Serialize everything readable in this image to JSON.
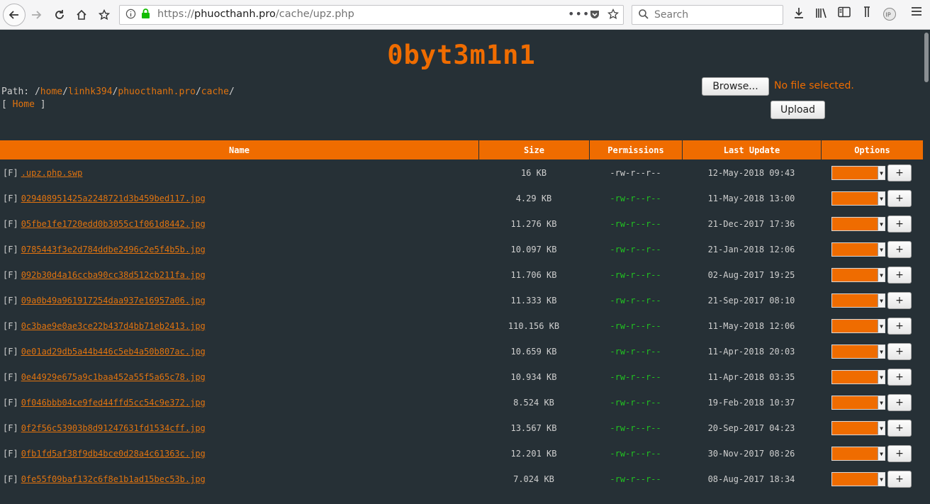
{
  "browser": {
    "url_prefix": "https://",
    "url_host": "phuocthanh.pro",
    "url_path": "/cache/upz.php",
    "search_placeholder": "Search"
  },
  "page": {
    "title": "0byt3m1n1",
    "path_label": "Path:",
    "path_sep": "/",
    "path_segments": [
      "home",
      "linhk394",
      "phuocthanh.pro",
      "cache"
    ],
    "home_open": "[",
    "home_link": "Home",
    "home_close": "]",
    "browse_label": "Browse...",
    "no_file_label": "No file selected.",
    "upload_label": "Upload"
  },
  "table": {
    "headers": [
      "Name",
      "Size",
      "Permissions",
      "Last Update",
      "Options"
    ],
    "type_tag": "[F]",
    "plus_label": "+",
    "rows": [
      {
        "name": ".upz.php.swp",
        "size": "16 KB",
        "perm": "-rw-r--r--",
        "perm_color": "#cfcfcf",
        "date": "12-May-2018 09:43"
      },
      {
        "name": "029408951425a2248721d3b459bed117.jpg",
        "size": "4.29 KB",
        "perm": "-rw-r--r--",
        "perm_color": "#21c321",
        "date": "11-May-2018 13:00"
      },
      {
        "name": "05fbe1fe1720edd0b3055c1f061d8442.jpg",
        "size": "11.276 KB",
        "perm": "-rw-r--r--",
        "perm_color": "#21c321",
        "date": "21-Dec-2017 17:36"
      },
      {
        "name": "0785443f3e2d784ddbe2496c2e5f4b5b.jpg",
        "size": "10.097 KB",
        "perm": "-rw-r--r--",
        "perm_color": "#21c321",
        "date": "21-Jan-2018 12:06"
      },
      {
        "name": "092b30d4a16ccba90cc38d512cb211fa.jpg",
        "size": "11.706 KB",
        "perm": "-rw-r--r--",
        "perm_color": "#21c321",
        "date": "02-Aug-2017 19:25"
      },
      {
        "name": "09a0b49a961917254daa937e16957a06.jpg",
        "size": "11.333 KB",
        "perm": "-rw-r--r--",
        "perm_color": "#21c321",
        "date": "21-Sep-2017 08:10"
      },
      {
        "name": "0c3bae9e0ae3ce22b437d4bb71eb2413.jpg",
        "size": "110.156 KB",
        "perm": "-rw-r--r--",
        "perm_color": "#21c321",
        "date": "11-May-2018 12:06"
      },
      {
        "name": "0e01ad29db5a44b446c5eb4a50b807ac.jpg",
        "size": "10.659 KB",
        "perm": "-rw-r--r--",
        "perm_color": "#21c321",
        "date": "11-Apr-2018 20:03"
      },
      {
        "name": "0e44929e675a9c1baa452a55f5a65c78.jpg",
        "size": "10.934 KB",
        "perm": "-rw-r--r--",
        "perm_color": "#21c321",
        "date": "11-Apr-2018 03:35"
      },
      {
        "name": "0f046bbb04ce9fed44ffd5cc54c9e372.jpg",
        "size": "8.524 KB",
        "perm": "-rw-r--r--",
        "perm_color": "#21c321",
        "date": "19-Feb-2018 10:37"
      },
      {
        "name": "0f2f56c53903b8d91247631fd1534cff.jpg",
        "size": "13.567 KB",
        "perm": "-rw-r--r--",
        "perm_color": "#21c321",
        "date": "20-Sep-2017 04:23"
      },
      {
        "name": "0fb1fd5af38f9db4bce0d28a4c61363c.jpg",
        "size": "12.201 KB",
        "perm": "-rw-r--r--",
        "perm_color": "#21c321",
        "date": "30-Nov-2017 08:26"
      },
      {
        "name": "0fe55f09baf132c6f8e1b1ad15bec53b.jpg",
        "size": "7.024 KB",
        "perm": "-rw-r--r--",
        "perm_color": "#21c321",
        "date": "08-Aug-2017 18:34"
      }
    ]
  }
}
